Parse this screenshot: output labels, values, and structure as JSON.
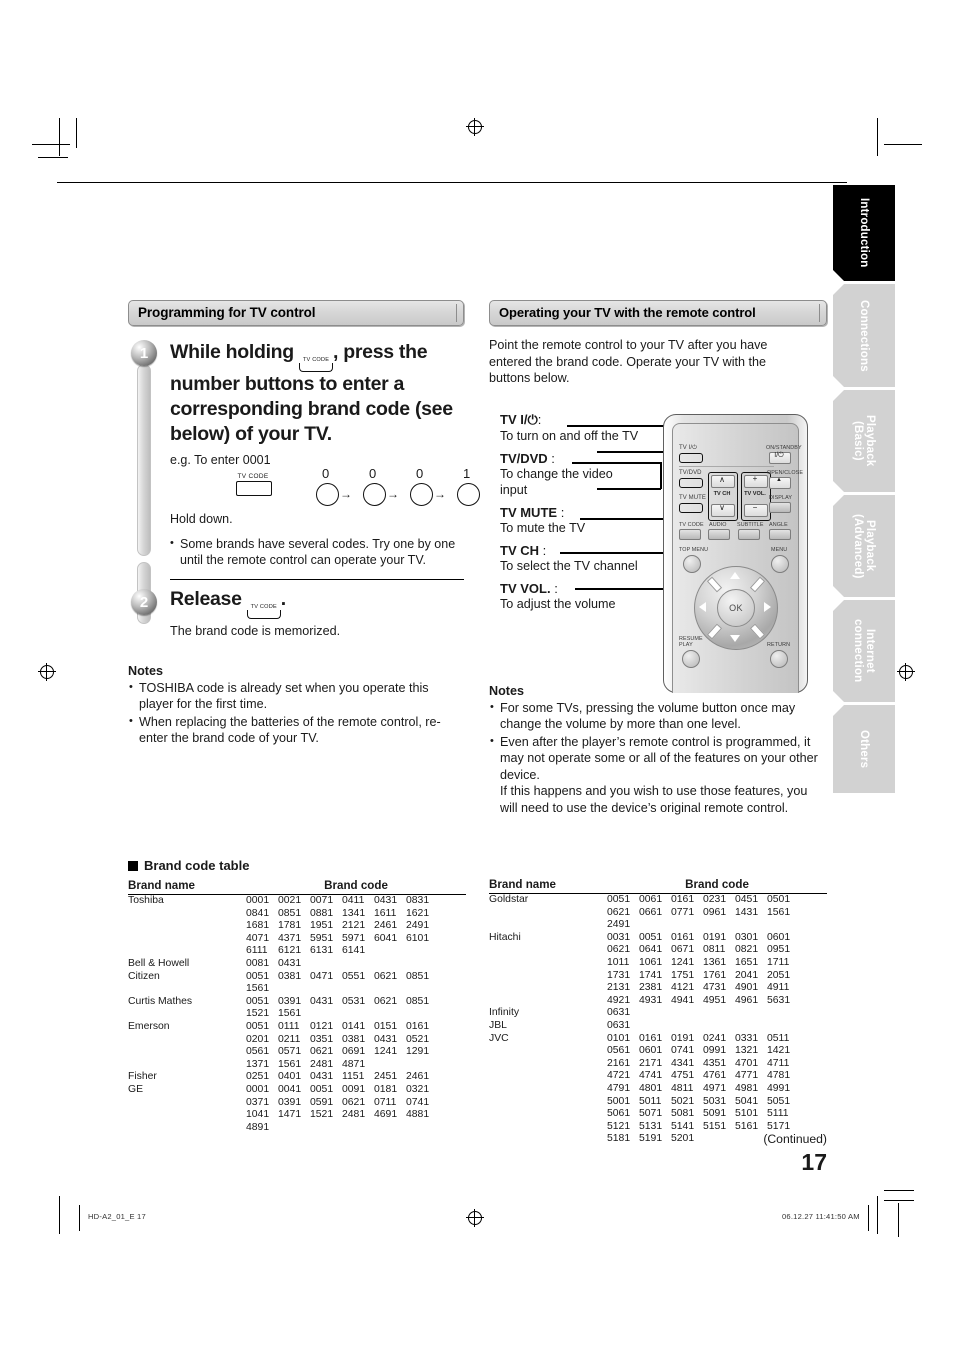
{
  "sidebar": {
    "tabs": [
      {
        "label": "Introduction",
        "active": true
      },
      {
        "label": "Connections",
        "active": false
      },
      {
        "label": "Playback\n(Basic)",
        "active": false
      },
      {
        "label": "Playback\n(Advanced)",
        "active": false
      },
      {
        "label": "Internet\nconnection",
        "active": false
      },
      {
        "label": "Others",
        "active": false
      }
    ]
  },
  "left": {
    "banner": "Programming for TV control",
    "step1": {
      "number": "1",
      "heading_part1": "While holding ",
      "tvcode_caption": "TV CODE",
      "heading_part2": ", press the number buttons to enter a corresponding brand code (see below) of your TV.",
      "example_label": "e.g. To enter 0001",
      "hold_down": "Hold down.",
      "digits": [
        "0",
        "0",
        "0",
        "1"
      ],
      "arrow": "→",
      "bullet": "Some brands have several codes. Try one by one until the remote control can operate your TV."
    },
    "step2": {
      "number": "2",
      "heading": "Release",
      "tvcode_caption": "TV CODE",
      "period": ".",
      "sub": "The brand code is memorized."
    },
    "notes_title": "Notes",
    "notes": [
      "TOSHIBA code is already set when you operate this player for the first time.",
      "When replacing the batteries of the remote control, re-enter the brand code of your TV."
    ]
  },
  "right": {
    "banner": "Operating your TV with the remote control",
    "intro": "Point the remote control to your TV after you have entered the brand code. Operate your TV with the buttons below.",
    "callouts": [
      {
        "name": "TV I/⏻",
        "colon": ":",
        "desc": "To turn on and off the TV"
      },
      {
        "name": "TV/DVD",
        "colon": ":",
        "desc": "To change the video input"
      },
      {
        "name": "TV MUTE",
        "colon": ":",
        "desc": "To mute the TV"
      },
      {
        "name": "TV CH",
        "colon": ":",
        "desc": "To select the TV channel"
      },
      {
        "name": "TV VOL.",
        "colon": ":",
        "desc": "To adjust the volume"
      }
    ],
    "notes_title": "Notes",
    "notes": [
      {
        "text": "For some TVs, pressing the volume button once may change the volume by more than one level."
      },
      {
        "text": "Even after the player’s remote control is programmed, it may not operate some or all of the features on your other device.",
        "cont": "If this happens and you wish to use those features, you will need to use the device’s original remote control."
      }
    ]
  },
  "remote": {
    "labels": {
      "tv_power": "TV I/⏻",
      "tv_dvd": "TV/DVD",
      "tv_mute": "TV MUTE",
      "tv_code": "TV CODE",
      "audio": "AUDIO",
      "subtitle": "SUBTITLE",
      "angle": "ANGLE",
      "onstandby": "ON/STANDBY",
      "onstandby_sym": "I/⏻",
      "openclose": "OPEN/CLOSE",
      "openclose_sym": "▲",
      "display": "DISPLAY",
      "topmenu": "TOP MENU",
      "menu": "MENU",
      "resume_play": "RESUME\nPLAY",
      "return": "RETURN",
      "tv_ch": "TV CH",
      "tv_vol": "TV VOL.",
      "ok": "OK",
      "up": "∧",
      "down": "∨",
      "plus": "+",
      "minus": "−"
    }
  },
  "tables": {
    "title": "Brand code table",
    "headers": {
      "brand_name": "Brand name",
      "brand_code": "Brand code"
    },
    "left_rows": [
      {
        "brand": "Toshiba",
        "codes": [
          "0001",
          "0021",
          "0071",
          "0411",
          "0431",
          "0831",
          "0841",
          "0851",
          "0881",
          "1341",
          "1611",
          "1621",
          "1681",
          "1781",
          "1951",
          "2121",
          "2461",
          "2491",
          "4071",
          "4371",
          "5951",
          "5971",
          "6041",
          "6101",
          "6111",
          "6121",
          "6131",
          "6141"
        ]
      },
      {
        "brand": "Bell & Howell",
        "codes": [
          "0081",
          "0431"
        ]
      },
      {
        "brand": "Citizen",
        "codes": [
          "0051",
          "0381",
          "0471",
          "0551",
          "0621",
          "0851",
          "1561"
        ]
      },
      {
        "brand": "Curtis Mathes",
        "codes": [
          "0051",
          "0391",
          "0431",
          "0531",
          "0621",
          "0851",
          "1521",
          "1561"
        ]
      },
      {
        "brand": "Emerson",
        "codes": [
          "0051",
          "0111",
          "0121",
          "0141",
          "0151",
          "0161",
          "0201",
          "0211",
          "0351",
          "0381",
          "0431",
          "0521",
          "0561",
          "0571",
          "0621",
          "0691",
          "1241",
          "1291",
          "1371",
          "1561",
          "2481",
          "4871"
        ]
      },
      {
        "brand": "Fisher",
        "codes": [
          "0251",
          "0401",
          "0431",
          "1151",
          "2451",
          "2461"
        ]
      },
      {
        "brand": "GE",
        "codes": [
          "0001",
          "0041",
          "0051",
          "0091",
          "0181",
          "0321",
          "0371",
          "0391",
          "0591",
          "0621",
          "0711",
          "0741",
          "1041",
          "1471",
          "1521",
          "2481",
          "4691",
          "4881",
          "4891"
        ]
      }
    ],
    "right_rows": [
      {
        "brand": "Goldstar",
        "codes": [
          "0051",
          "0061",
          "0161",
          "0231",
          "0451",
          "0501",
          "0621",
          "0661",
          "0771",
          "0961",
          "1431",
          "1561",
          "2491"
        ]
      },
      {
        "brand": "Hitachi",
        "codes": [
          "0031",
          "0051",
          "0161",
          "0191",
          "0301",
          "0601",
          "0621",
          "0641",
          "0671",
          "0811",
          "0821",
          "0951",
          "1011",
          "1061",
          "1241",
          "1361",
          "1651",
          "1711",
          "1731",
          "1741",
          "1751",
          "1761",
          "2041",
          "2051",
          "2131",
          "2381",
          "4121",
          "4731",
          "4901",
          "4911",
          "4921",
          "4931",
          "4941",
          "4951",
          "4961",
          "5631"
        ]
      },
      {
        "brand": "Infinity",
        "codes": [
          "0631"
        ]
      },
      {
        "brand": "JBL",
        "codes": [
          "0631"
        ]
      },
      {
        "brand": "JVC",
        "codes": [
          "0101",
          "0161",
          "0191",
          "0241",
          "0331",
          "0511",
          "0561",
          "0601",
          "0741",
          "0991",
          "1321",
          "1421",
          "2161",
          "2171",
          "4341",
          "4351",
          "4701",
          "4711",
          "4721",
          "4741",
          "4751",
          "4761",
          "4771",
          "4781",
          "4791",
          "4801",
          "4811",
          "4971",
          "4981",
          "4991",
          "5001",
          "5011",
          "5021",
          "5031",
          "5041",
          "5051",
          "5061",
          "5071",
          "5081",
          "5091",
          "5101",
          "5111",
          "5121",
          "5131",
          "5141",
          "5151",
          "5161",
          "5171",
          "5181",
          "5191",
          "5201"
        ]
      }
    ]
  },
  "footer": {
    "continued": "(Continued)",
    "page_number": "17",
    "file_id": "HD-A2_01_E   17",
    "timestamp": "06.12.27   11:41:50 AM"
  }
}
